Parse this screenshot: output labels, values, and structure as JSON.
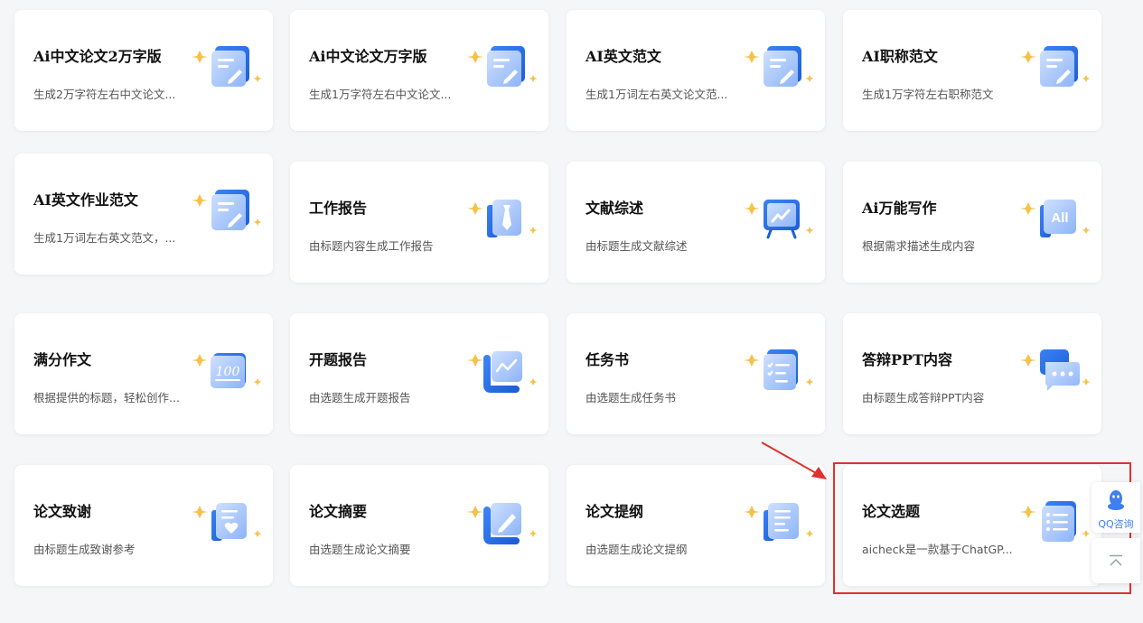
{
  "cards": [
    {
      "title": "Ai中文论文2万字版",
      "desc": "生成2万字符左右中文论文...",
      "icon": "document-pen-icon"
    },
    {
      "title": "Ai中文论文万字版",
      "desc": "生成1万字符左右中文论文...",
      "icon": "document-pen-icon"
    },
    {
      "title": "AI英文范文",
      "desc": "生成1万词左右英文论文范...",
      "icon": "document-pen-icon"
    },
    {
      "title": "AI职称范文",
      "desc": "生成1万字符左右职称范文",
      "icon": "document-pen-icon"
    },
    {
      "title": "AI英文作业范文",
      "desc": "生成1万词左右英文范文，...",
      "icon": "document-pen-icon"
    },
    {
      "title": "工作报告",
      "desc": "由标题内容生成工作报告",
      "icon": "necktie-icon"
    },
    {
      "title": "文献综述",
      "desc": "由标题生成文献综述",
      "icon": "presentation-board-icon"
    },
    {
      "title": "Ai万能写作",
      "desc": "根据需求描述生成内容",
      "icon": "all-badge-icon"
    },
    {
      "title": "满分作文",
      "desc": "根据提供的标题，轻松创作...",
      "icon": "score-100-icon"
    },
    {
      "title": "开题报告",
      "desc": "由选题生成开题报告",
      "icon": "line-chart-icon"
    },
    {
      "title": "任务书",
      "desc": "由选题生成任务书",
      "icon": "checklist-icon"
    },
    {
      "title": "答辩PPT内容",
      "desc": "由标题生成答辩PPT内容",
      "icon": "chat-bubble-icon"
    },
    {
      "title": "论文致谢",
      "desc": "由标题生成致谢参考",
      "icon": "heart-document-icon"
    },
    {
      "title": "论文摘要",
      "desc": "由选题生成论文摘要",
      "icon": "pencil-icon"
    },
    {
      "title": "论文提纲",
      "desc": "由选题生成论文提纲",
      "icon": "outline-document-icon"
    },
    {
      "title": "论文选题",
      "desc": "aicheck是一款基于ChatGP...",
      "icon": "list-icon"
    }
  ],
  "float": {
    "qq_label": "QQ咨询"
  },
  "colors": {
    "accent_blue": "#3f7ff0",
    "sparkle": "#f6c14a",
    "highlight_red": "#e0312d"
  }
}
